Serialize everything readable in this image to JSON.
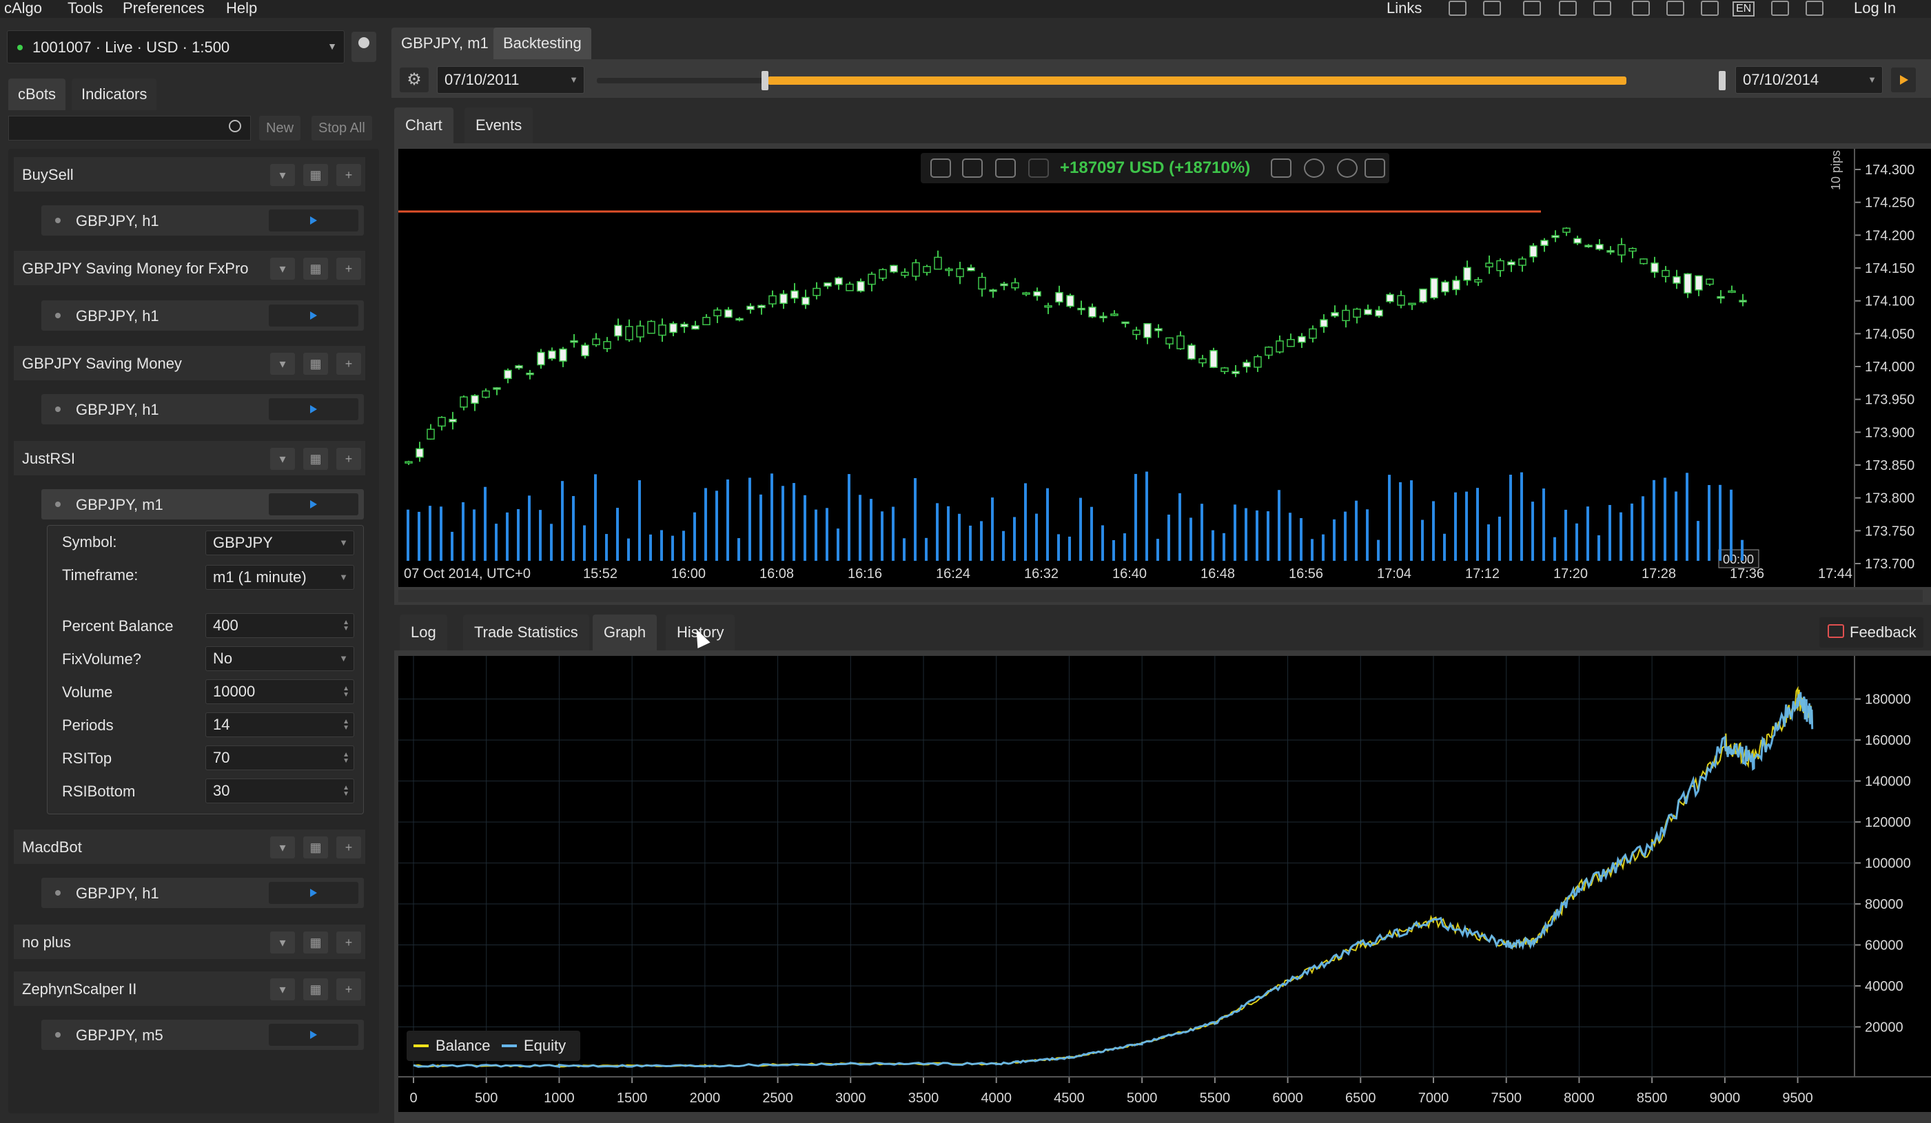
{
  "menu": [
    "cAlgo",
    "Tools",
    "Preferences",
    "Help"
  ],
  "topbar": {
    "links": "Links",
    "login": "Log In",
    "lang": "EN"
  },
  "account": {
    "label": "1001007 · Live · USD · 1:500"
  },
  "left_tabs": [
    "cBots",
    "Indicators"
  ],
  "toolbar_buttons": {
    "new": "New",
    "stop_all": "Stop All"
  },
  "bots": [
    {
      "name": "BuySell",
      "instances": [
        "GBPJPY, h1"
      ]
    },
    {
      "name": "GBPJPY Saving Money for FxPro",
      "instances": [
        "GBPJPY, h1"
      ]
    },
    {
      "name": "GBPJPY Saving Money",
      "instances": [
        "GBPJPY, h1"
      ]
    },
    {
      "name": "JustRSI",
      "instances": [
        "GBPJPY, m1"
      ]
    },
    {
      "name": "MacdBot",
      "instances": [
        "GBPJPY, h1"
      ]
    },
    {
      "name": "no plus",
      "instances": []
    },
    {
      "name": "ZephynScalper II",
      "instances": [
        "GBPJPY, m5"
      ]
    }
  ],
  "params": [
    {
      "label": "Symbol:",
      "value": "GBPJPY",
      "kind": "select"
    },
    {
      "label": "Timeframe:",
      "value": "m1 (1 minute)",
      "kind": "select"
    },
    {
      "label": "Percent Balance",
      "value": "400",
      "kind": "spin"
    },
    {
      "label": "FixVolume?",
      "value": "No",
      "kind": "select"
    },
    {
      "label": "Volume",
      "value": "10000",
      "kind": "spin"
    },
    {
      "label": "Periods",
      "value": "14",
      "kind": "spin"
    },
    {
      "label": "RSITop",
      "value": "70",
      "kind": "spin"
    },
    {
      "label": "RSIBottom",
      "value": "30",
      "kind": "spin"
    }
  ],
  "main_tabs": [
    "GBPJPY, m1",
    "Backtesting"
  ],
  "backtest": {
    "start_date": "07/10/2011",
    "end_date": "07/10/2014"
  },
  "chart_tabs": [
    "Chart",
    "Events"
  ],
  "chart_toolbar": {
    "pnl": "+187097 USD (+18710%)"
  },
  "price_chart": {
    "scale_label": "10 pips",
    "price_ticks": [
      "174.300",
      "174.250",
      "174.200",
      "174.150",
      "174.100",
      "174.050",
      "174.000",
      "173.950",
      "173.900",
      "173.850",
      "173.800",
      "173.750",
      "173.700"
    ],
    "time_ticks": [
      "07 Oct 2014, UTC+0",
      "15:52",
      "16:00",
      "16:08",
      "16:16",
      "16:24",
      "16:32",
      "16:40",
      "16:48",
      "16:56",
      "17:04",
      "17:12",
      "17:20",
      "17:28",
      "17:36",
      "17:44"
    ],
    "time_marker": "00:00",
    "colors": {
      "up": "#3ec44a",
      "down": "#f2f2f2",
      "volume": "#2a8ae6",
      "level": "#e0502a"
    }
  },
  "bottom_tabs": [
    "Log",
    "Trade Statistics",
    "Graph",
    "History"
  ],
  "feedback": "Feedback",
  "chart_data": {
    "type": "line",
    "xlabel": "",
    "ylabel": "",
    "xlim": [
      0,
      9800
    ],
    "ylim": [
      0,
      195000
    ],
    "x_ticks": [
      "0",
      "500",
      "1000",
      "1500",
      "2000",
      "2500",
      "3000",
      "3500",
      "4000",
      "4500",
      "5000",
      "5500",
      "6000",
      "6500",
      "7000",
      "7500",
      "8000",
      "8500",
      "9000",
      "9500"
    ],
    "y_ticks": [
      "20000",
      "40000",
      "60000",
      "80000",
      "100000",
      "120000",
      "140000",
      "160000",
      "180000"
    ],
    "legend_placement": "bottom-left",
    "series": [
      {
        "name": "Balance",
        "color": "#f2e21b",
        "x": [
          0,
          1000,
          2000,
          3000,
          4000,
          4500,
          5000,
          5500,
          6000,
          6500,
          7000,
          7500,
          7700,
          8000,
          8500,
          9000,
          9200,
          9500,
          9600
        ],
        "y": [
          1000,
          1000,
          1000,
          2000,
          2000,
          5000,
          12000,
          22000,
          42000,
          60000,
          72000,
          60000,
          62000,
          88000,
          108000,
          158000,
          150000,
          180000,
          170000
        ]
      },
      {
        "name": "Equity",
        "color": "#67b6ea",
        "x": [
          0,
          1000,
          2000,
          3000,
          4000,
          4500,
          5000,
          5500,
          6000,
          6500,
          7000,
          7500,
          7700,
          8000,
          8500,
          9000,
          9200,
          9500,
          9600
        ],
        "y": [
          1000,
          1000,
          1000,
          2000,
          2000,
          5000,
          12000,
          22000,
          42000,
          60000,
          72000,
          60000,
          62000,
          88000,
          108000,
          158000,
          150000,
          180000,
          170000
        ]
      }
    ]
  }
}
